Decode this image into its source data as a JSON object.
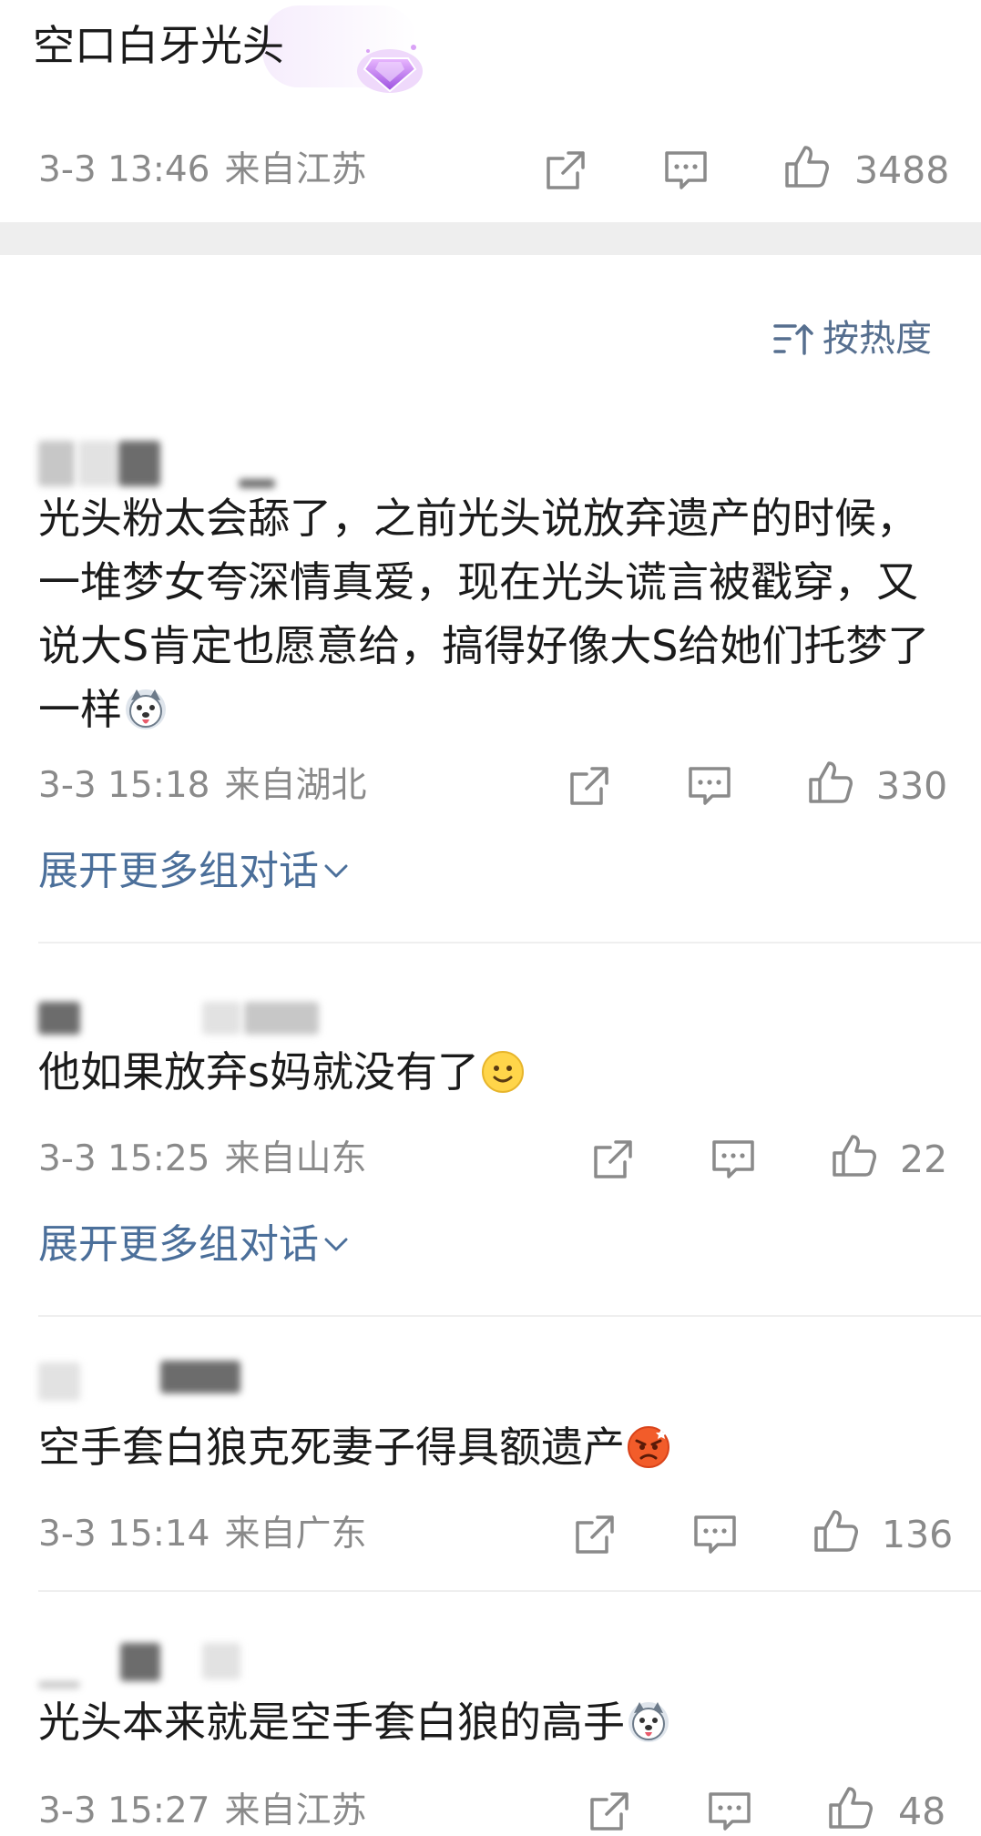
{
  "top": {
    "username": "空口白牙光头",
    "time": "3-3 13:46",
    "location": "来自江苏",
    "likes": "3488"
  },
  "sort": {
    "label": "按热度"
  },
  "comments": [
    {
      "text": "光头粉太会舔了，之前光头说放弃遗产的时候，一堆梦女夸深情真爱，现在光头谎言被戳穿，又说大S肯定也愿意给，搞得好像大S给她们托梦了一样",
      "emoji": "husky-emoji",
      "time": "3-3 15:18",
      "location": "来自湖北",
      "likes": "330",
      "expand": "展开更多组对话"
    },
    {
      "text": "他如果放弃s妈就没有了",
      "emoji": "smile-emoji",
      "time": "3-3 15:25",
      "location": "来自山东",
      "likes": "22",
      "expand": "展开更多组对话"
    },
    {
      "text": "空手套白狼克死妻子得具额遗产",
      "emoji": "angry-emoji",
      "time": "3-3 15:14",
      "location": "来自广东",
      "likes": "136"
    },
    {
      "text": "光头本来就是空手套白狼的高手",
      "emoji": "husky-emoji",
      "time": "3-3 15:27",
      "location": "来自江苏",
      "likes": "48"
    }
  ],
  "colors": {
    "link": "#4b6f9a",
    "meta": "#8a8a8a",
    "badge": "#b56cf0"
  }
}
